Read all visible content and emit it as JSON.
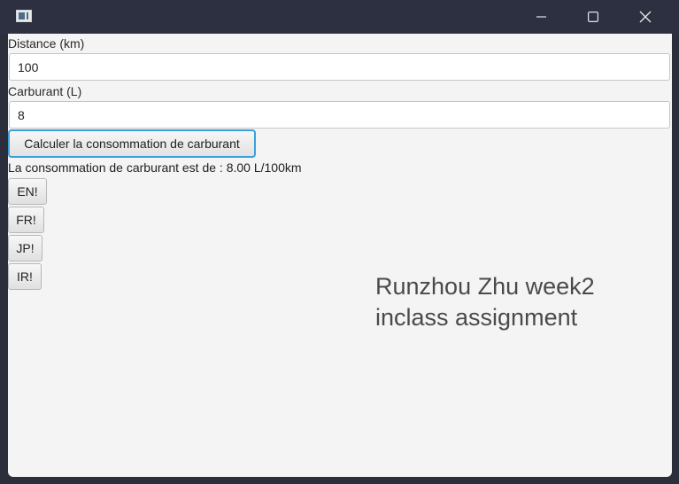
{
  "window": {
    "controls": {
      "minimize_icon": "minimize-icon",
      "maximize_icon": "maximize-icon",
      "close_icon": "close-icon"
    },
    "titlebar_color": "#2d3040",
    "background_color": "#f4f4f4"
  },
  "form": {
    "distance_label": "Distance (km)",
    "distance_value": "100",
    "fuel_label": "Carburant (L)",
    "fuel_value": "8",
    "calculate_label": "Calculer la consommation de carburant",
    "result_text": "La consommation de carburant est de : 8.00 L/100km",
    "focus_color": "#3ba0d8"
  },
  "languages": [
    {
      "label": "EN!"
    },
    {
      "label": "FR!"
    },
    {
      "label": "JP!"
    },
    {
      "label": "IR!"
    }
  ],
  "caption": {
    "line1": "Runzhou Zhu week2",
    "line2": "inclass assignment"
  }
}
